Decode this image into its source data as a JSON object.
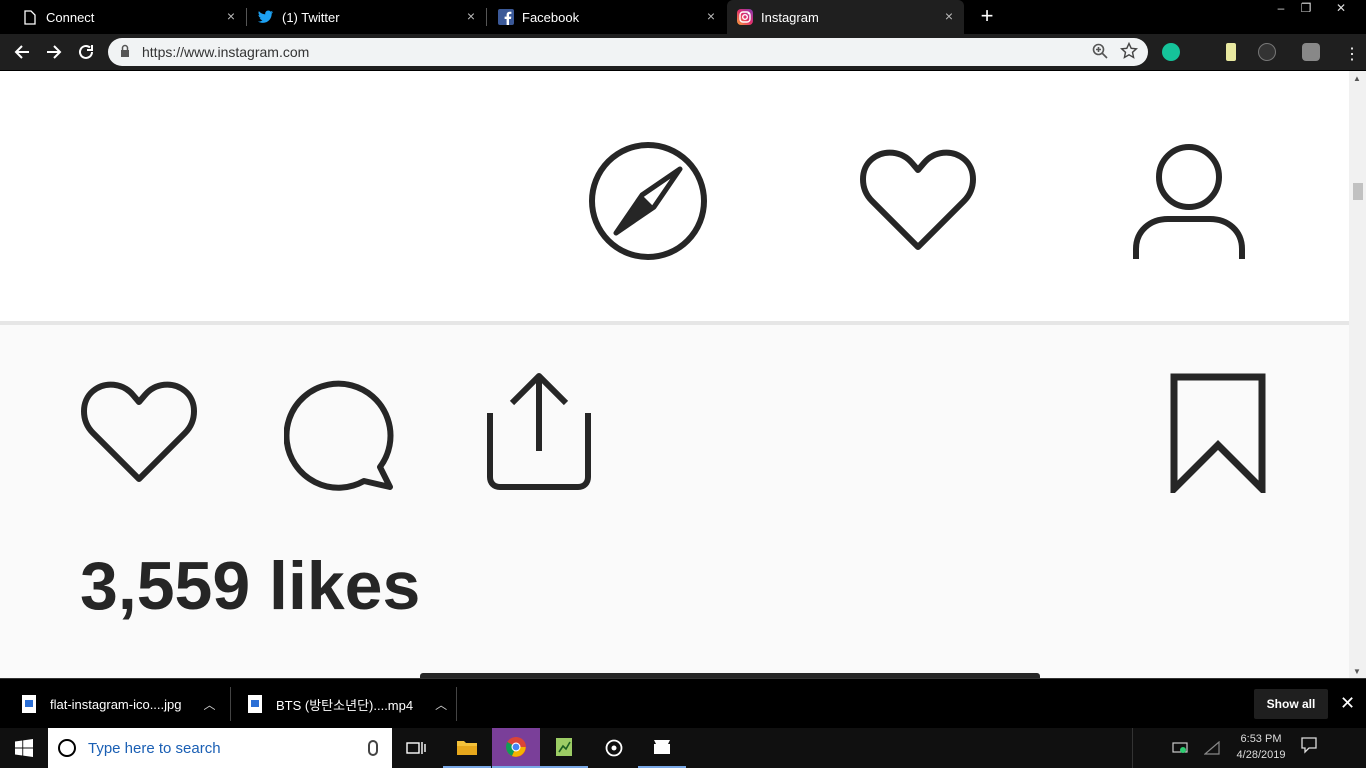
{
  "browser": {
    "tabs": [
      {
        "label": "Connect",
        "icon": "document-icon",
        "active": false
      },
      {
        "label": "(1) Twitter",
        "icon": "twitter-icon",
        "active": false
      },
      {
        "label": "Facebook",
        "icon": "facebook-icon",
        "active": false
      },
      {
        "label": "Instagram",
        "icon": "instagram-icon",
        "active": true
      }
    ],
    "new_tab": "+",
    "url": "https://www.instagram.com"
  },
  "page": {
    "likes_text": "3,559 likes"
  },
  "downloads": {
    "items": [
      {
        "name": "flat-instagram-ico....jpg"
      },
      {
        "name": "BTS (방탄소년단)....mp4"
      }
    ],
    "show_all": "Show all"
  },
  "taskbar": {
    "search_placeholder": "Type here to search",
    "time": "6:53 PM",
    "date": "4/28/2019"
  },
  "colors": {
    "icon_stroke": "#262626",
    "accent_blue": "#1a5fb4"
  }
}
